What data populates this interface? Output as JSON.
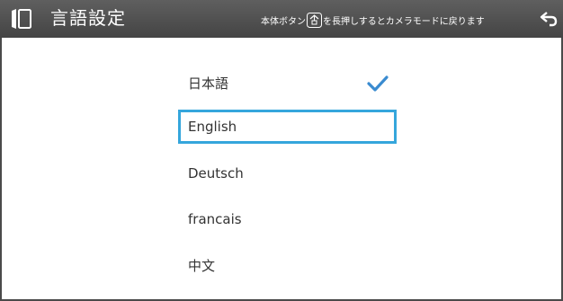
{
  "header": {
    "title": "言語設定",
    "hint_prefix": "本体ボタン",
    "hint_suffix": "を長押しするとカメラモードに戻ります",
    "left_icon": "display-settings-icon",
    "hint_icon": "camera-button-icon",
    "back_icon": "back-arrow-icon"
  },
  "languages": {
    "items": [
      {
        "label": "日本語",
        "checked": true,
        "focused": false
      },
      {
        "label": "English",
        "checked": false,
        "focused": true
      },
      {
        "label": "Deutsch",
        "checked": false,
        "focused": false
      },
      {
        "label": "francais",
        "checked": false,
        "focused": false
      },
      {
        "label": "中文",
        "checked": false,
        "focused": false
      }
    ],
    "check_icon": "checkmark-icon"
  },
  "colors": {
    "header_background": "#4f4f4f",
    "accent": "#35a6dc",
    "text": "#333333"
  }
}
